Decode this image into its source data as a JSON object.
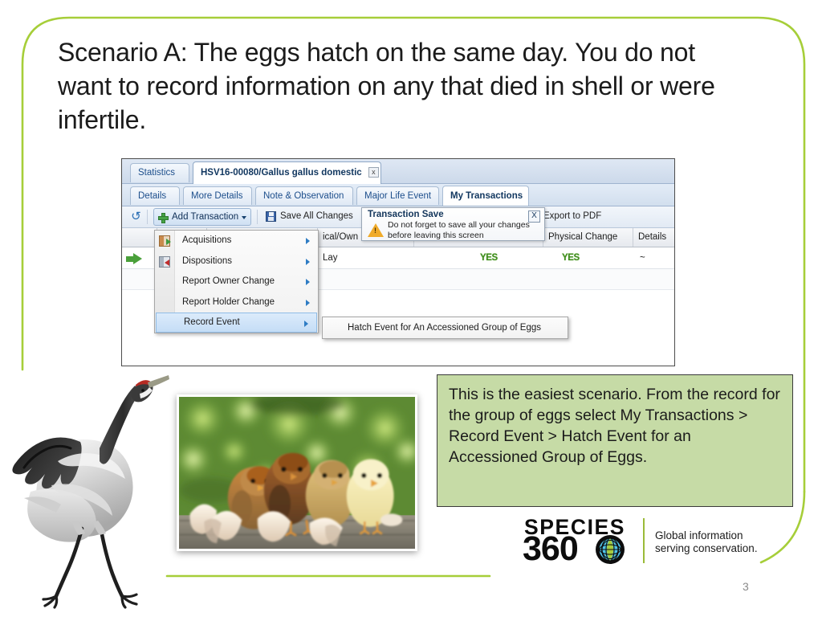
{
  "slide": {
    "title": "Scenario A: The eggs hatch on the same day. You do not want to record information on any that died in shell or were infertile.",
    "page_number": "3",
    "accent_green": "#a6ce39",
    "callout_bg": "#c6dba6"
  },
  "app": {
    "primary_tabs": [
      {
        "label": "Statistics",
        "active": false
      },
      {
        "label": "HSV16-00080/Gallus gallus domestic",
        "active": true,
        "close_label": "x"
      }
    ],
    "secondary_tabs": [
      {
        "label": "Details",
        "active": false
      },
      {
        "label": "More Details",
        "active": false
      },
      {
        "label": "Note & Observation",
        "active": false
      },
      {
        "label": "Major Life Event",
        "active": false
      },
      {
        "label": "My Transactions",
        "active": true
      }
    ],
    "toolbar": {
      "refresh_icon": "refresh-icon",
      "add_transaction": "Add Transaction",
      "save_all_changes": "Save All Changes",
      "export_to_pdf": "Export to PDF"
    },
    "menu": {
      "items": [
        {
          "label": "Acquisitions",
          "icon": "door-enter-icon",
          "has_submenu": true,
          "highlighted": false
        },
        {
          "label": "Dispositions",
          "icon": "door-exit-icon",
          "has_submenu": true,
          "highlighted": false
        },
        {
          "label": "Report Owner Change",
          "icon": "",
          "has_submenu": true,
          "highlighted": false
        },
        {
          "label": "Report Holder Change",
          "icon": "",
          "has_submenu": true,
          "highlighted": false
        },
        {
          "label": "Record Event",
          "icon": "",
          "has_submenu": true,
          "highlighted": true
        }
      ]
    },
    "submenu": {
      "items": [
        {
          "label": "Hatch Event for An Accessioned Group of Eggs"
        }
      ]
    },
    "tooltip": {
      "title": "Transaction Save",
      "body": "Do not forget to save all your changes before leaving this screen",
      "close_label": "X",
      "icon": "warning-icon"
    },
    "grid": {
      "headers": [
        {
          "label": "ical/Own"
        },
        {
          "label": "Physical Change"
        },
        {
          "label": "Details"
        }
      ],
      "rows": [
        {
          "type_label": "Lay",
          "physical_change": "YES",
          "second_yes": "YES",
          "details": "~"
        }
      ]
    }
  },
  "callout": {
    "text": "This is the easiest scenario. From the record for the group of eggs select My Transactions > Record Event > Hatch Event for an Accessioned Group of Eggs."
  },
  "logo": {
    "word_top": "SPECIES",
    "word_bottom": "360",
    "tagline_line1": "Global information",
    "tagline_line2": "serving conservation.",
    "globe_icon": "globe-icon"
  },
  "images": {
    "photo": "baby-chicks-with-eggshells-photo",
    "bird": "crane-bird-illustration"
  }
}
